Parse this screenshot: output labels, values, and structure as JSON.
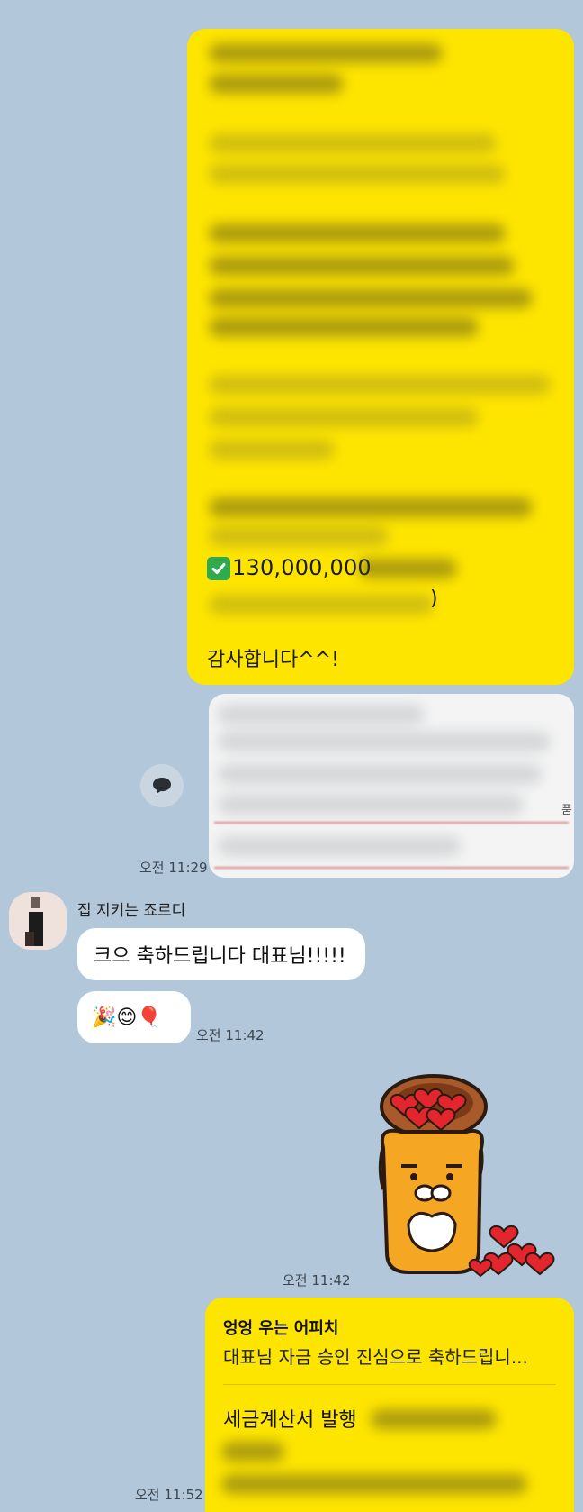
{
  "chat": {
    "colors": {
      "background": "#b2c7da",
      "my_bubble": "#fee500",
      "their_bubble": "#ffffff"
    },
    "message_1": {
      "amount_text": "130,000,000",
      "closing_paren": ")",
      "closing_text": "감사합니다^^!",
      "check_icon": "white-check-mark-icon"
    },
    "attachment": {
      "label_fragment": "품",
      "time": "오전 11:29",
      "share_icon": "share-speech-icon"
    },
    "incoming": {
      "sender": "집 지키는 죠르디",
      "message_1": "크으 축하드립니다 대표님!!!!!",
      "message_2_emojis": "🎉😊🎈",
      "time": "오전 11:42"
    },
    "sticker": {
      "name": "ryan-heart-basket-sticker",
      "time": "오전 11:42"
    },
    "reply": {
      "quoted_name": "엉엉 우는 어피치",
      "quoted_text": "대표님 자금 승인 진심으로 축하드립니...",
      "main_text": "세금계산서 발행",
      "time": "오전 11:52"
    }
  }
}
